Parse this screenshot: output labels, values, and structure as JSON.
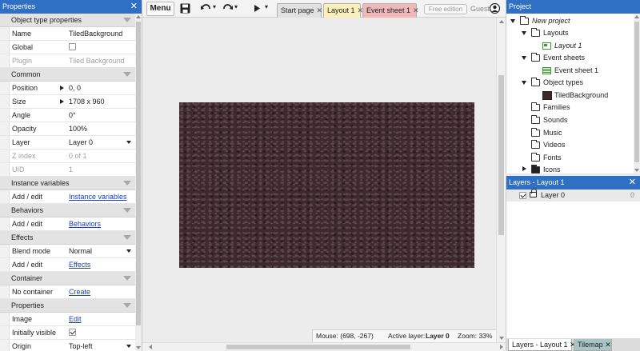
{
  "properties_panel": {
    "title": "Properties",
    "close": "✕",
    "rows": [
      {
        "type": "section",
        "label": "Object type properties"
      },
      {
        "type": "prop",
        "key": "Name",
        "value": "TiledBackground"
      },
      {
        "type": "prop",
        "key": "Global",
        "checkbox": "unchecked"
      },
      {
        "type": "prop",
        "key": "Plugin",
        "value": "Tiled Background",
        "dim": true
      },
      {
        "type": "section",
        "label": "Common"
      },
      {
        "type": "prop",
        "key": "Position",
        "value": "0, 0",
        "expander": true
      },
      {
        "type": "prop",
        "key": "Size",
        "value": "1708 x 960",
        "expander": true
      },
      {
        "type": "prop",
        "key": "Angle",
        "value": "0°"
      },
      {
        "type": "prop",
        "key": "Opacity",
        "value": "100%"
      },
      {
        "type": "prop",
        "key": "Layer",
        "value": "Layer 0",
        "dropdown": true
      },
      {
        "type": "prop",
        "key": "Z index",
        "value": "0 of 1",
        "dim": true
      },
      {
        "type": "prop",
        "key": "UID",
        "value": "1",
        "dim": true
      },
      {
        "type": "section",
        "label": "Instance variables"
      },
      {
        "type": "prop",
        "key": "Add / edit",
        "link": "Instance variables"
      },
      {
        "type": "section",
        "label": "Behaviors"
      },
      {
        "type": "prop",
        "key": "Add / edit",
        "link": "Behaviors"
      },
      {
        "type": "section",
        "label": "Effects"
      },
      {
        "type": "prop",
        "key": "Blend mode",
        "value": "Normal",
        "dropdown": true
      },
      {
        "type": "prop",
        "key": "Add / edit",
        "link": "Effects"
      },
      {
        "type": "section",
        "label": "Container"
      },
      {
        "type": "prop",
        "key": "No container",
        "link": "Create"
      },
      {
        "type": "section",
        "label": "Properties"
      },
      {
        "type": "prop",
        "key": "Image",
        "link": "Edit"
      },
      {
        "type": "prop",
        "key": "Initially visible",
        "checkbox": "checked"
      },
      {
        "type": "prop",
        "key": "Origin",
        "value": "Top-left",
        "dropdown": true
      }
    ]
  },
  "toolbar": {
    "menu_label": "Menu",
    "save_icon": "floppy-icon",
    "undo_icon": "undo-icon",
    "redo_icon": "redo-icon",
    "run_icon": "play-icon",
    "dropdown_glyph": "▾",
    "tabs": [
      {
        "label": "Start page",
        "color": "#e1e1e1"
      },
      {
        "label": "Layout 1",
        "color": "#fbf0b9"
      },
      {
        "label": "Event sheet 1",
        "color": "#f0b9b9"
      }
    ],
    "tab_close": "✕",
    "edition_label": "Free edition",
    "user_label": "Guest"
  },
  "layout_view": {
    "object_name": "TiledBackground",
    "status": {
      "mouse": "Mouse: (698, -267)",
      "active_layer_prefix": "Active layer:",
      "active_layer": "Layer 0",
      "zoom": "Zoom: 33%"
    }
  },
  "project_panel": {
    "title": "Project",
    "close": "✕",
    "tree": {
      "root": "New project",
      "layouts_folder": "Layouts",
      "layout_item": "Layout 1",
      "event_sheets_folder": "Event sheets",
      "event_sheet_item": "Event sheet 1",
      "object_types_folder": "Object types",
      "object_item": "TiledBackground",
      "families": "Families",
      "sounds": "Sounds",
      "music": "Music",
      "videos": "Videos",
      "fonts": "Fonts",
      "icons": "Icons"
    }
  },
  "layers_panel": {
    "title": "Layers - Layout 1",
    "close": "✕",
    "layer_name": "Layer 0",
    "layer_index": "0"
  },
  "bottom_tabs": {
    "layers_tab": "Layers - Layout 1",
    "tilemap_tab": "Tilemap",
    "close": "✕"
  },
  "colors": {
    "panel_title_bg": "#2f6fc4",
    "layout_tab": "#fbf0b9",
    "event_tab": "#f0b9b9",
    "tilemap_tab": "#a9c4c7"
  }
}
